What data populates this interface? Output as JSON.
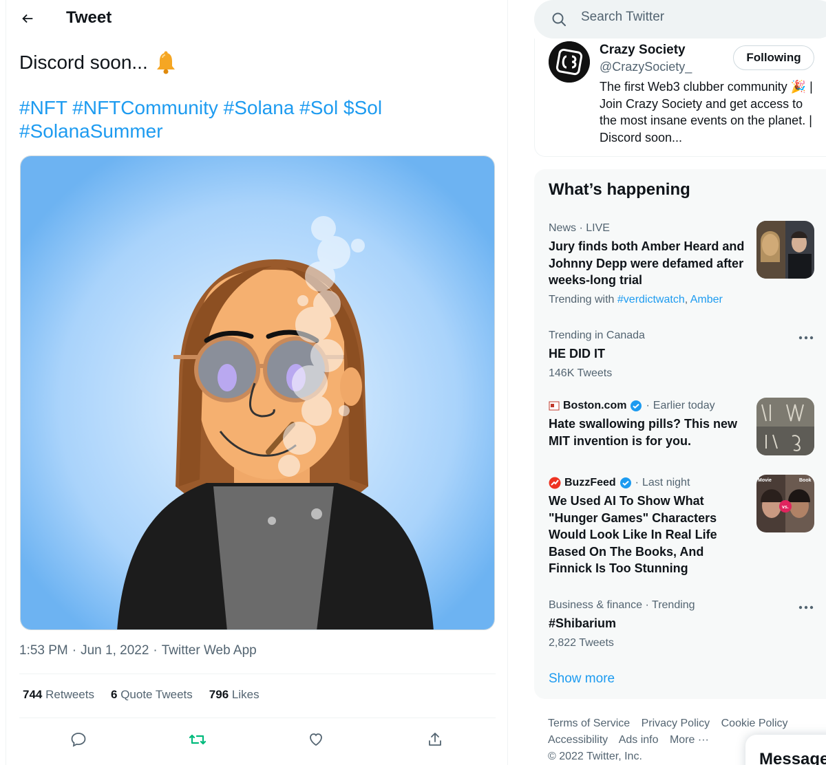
{
  "header": {
    "title": "Tweet"
  },
  "tweet": {
    "text": "Discord soon...",
    "hashtags": "#NFT #NFTCommunity #Solana #Sol $Sol #SolanaSummer",
    "time": "1:53 PM",
    "date": "Jun 1, 2022",
    "source": "Twitter Web App",
    "dot": "·",
    "stats": {
      "retweets": "744",
      "retweets_label": "Retweets",
      "quotes": "6",
      "quotes_label": "Quote Tweets",
      "likes": "796",
      "likes_label": "Likes"
    }
  },
  "search": {
    "placeholder": "Search Twitter"
  },
  "profile": {
    "name": "Crazy Society",
    "handle": "@CrazySociety_",
    "follow_label": "Following",
    "bio": "The first Web3 clubber community 🎉 | Join Crazy Society and get access to the most insane events on the planet. | Discord soon..."
  },
  "whats_happening": {
    "title": "What’s happening",
    "trends": [
      {
        "context": "News · LIVE",
        "headline": "Jury finds both Amber Heard and Johnny Depp were defamed after weeks-long trial",
        "trending_with_label": "Trending with",
        "tag1": "#verdictwatch",
        "comma": ",",
        "tag2": "Amber"
      },
      {
        "context": "Trending in Canada",
        "headline": "HE DID IT",
        "count": "146K Tweets"
      },
      {
        "source": "Boston.com",
        "time": "Earlier today",
        "headline": "Hate swallowing pills? This new MIT invention is for you."
      },
      {
        "source": "BuzzFeed",
        "time": "Last night",
        "headline": "We Used AI To Show What \"Hunger Games\" Characters Would Look Like In Real Life Based On The Books, And Finnick Is Too Stunning",
        "thumb_left": "Movie",
        "thumb_vs": "vs.",
        "thumb_right": "Book"
      },
      {
        "context": "Business & finance · Trending",
        "headline": "#Shibarium",
        "count": "2,822 Tweets"
      }
    ],
    "show_more": "Show more"
  },
  "footer": {
    "terms": "Terms of Service",
    "privacy": "Privacy Policy",
    "cookie": "Cookie Policy",
    "accessibility": "Accessibility",
    "ads": "Ads info",
    "more": "More ···",
    "copyright": "© 2022 Twitter, Inc."
  },
  "messages": {
    "label": "Messages"
  },
  "colors": {
    "accent": "#1d9bf0",
    "retweet_green": "#00ba7c",
    "text_secondary": "#536471",
    "verified": "#1d9bf0"
  }
}
